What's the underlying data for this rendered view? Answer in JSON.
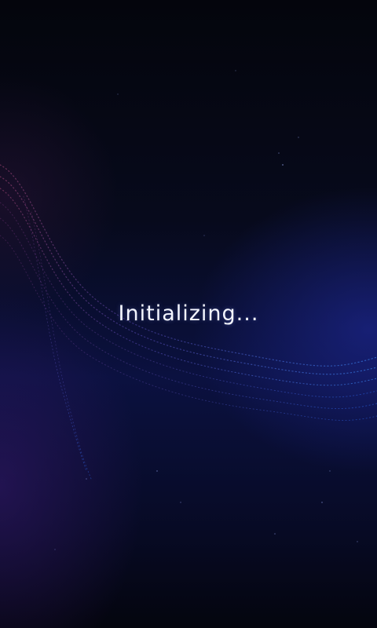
{
  "splash": {
    "status_text": "Initializing..."
  },
  "colors": {
    "background_top": "#04050c",
    "background_mid": "#0b1140",
    "accent_blue": "#2a3cc8",
    "accent_purple": "#6a2a9a",
    "text": "#f4f6ff"
  },
  "background": {
    "decoration": "particle-wave"
  }
}
